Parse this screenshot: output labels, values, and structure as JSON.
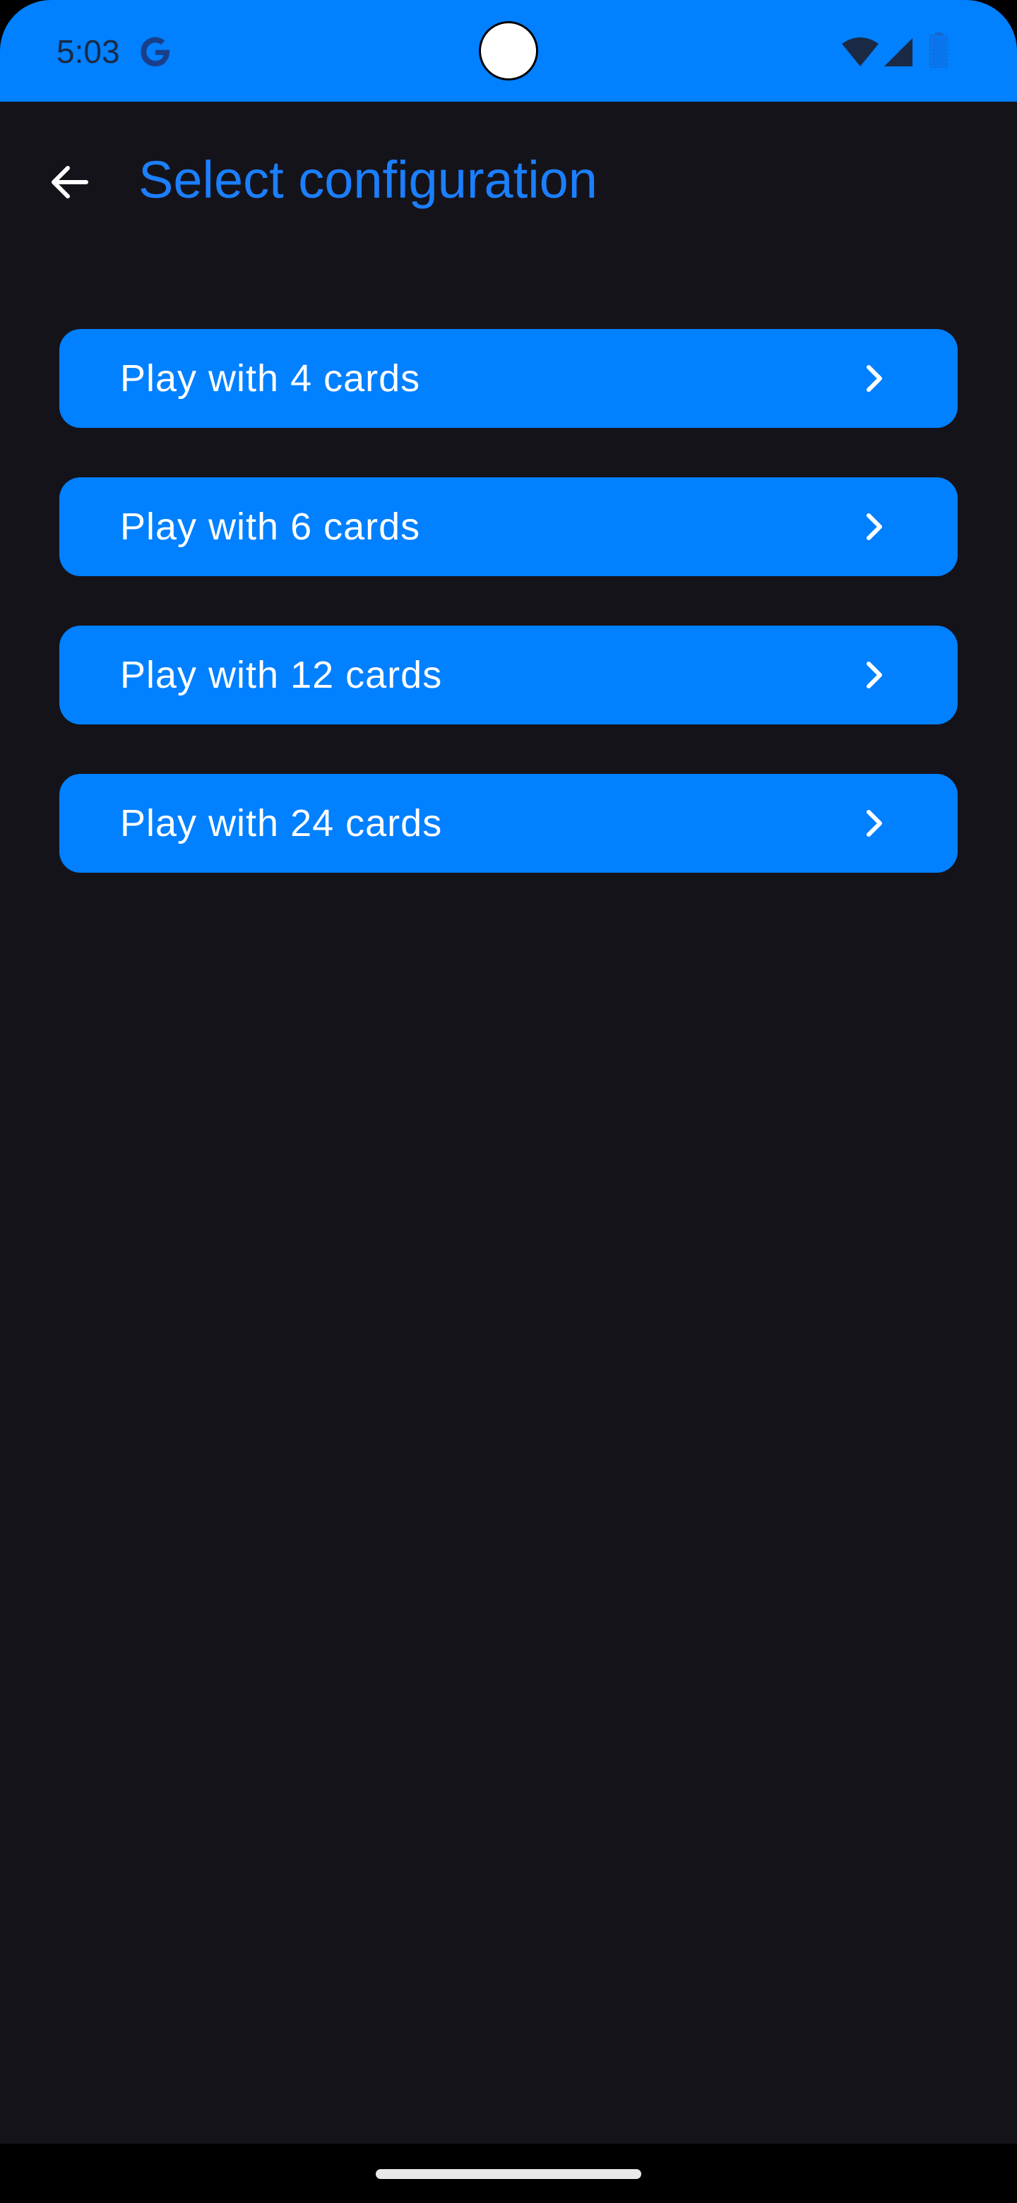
{
  "status_bar": {
    "time": "5:03",
    "icons": [
      "google-g-icon",
      "wifi-icon",
      "cell-signal-icon",
      "battery-icon"
    ]
  },
  "app_bar": {
    "back_icon": "arrow-back-icon",
    "title": "Select configuration"
  },
  "options": [
    {
      "label": "Play with 4 cards",
      "icon": "chevron-right-icon"
    },
    {
      "label": "Play with 6 cards",
      "icon": "chevron-right-icon"
    },
    {
      "label": "Play with 12 cards",
      "icon": "chevron-right-icon"
    },
    {
      "label": "Play with 24 cards",
      "icon": "chevron-right-icon"
    }
  ],
  "colors": {
    "accent": "#0180ff",
    "background": "#15131a",
    "title": "#1b7fff",
    "text_on_accent": "#ffffff"
  }
}
